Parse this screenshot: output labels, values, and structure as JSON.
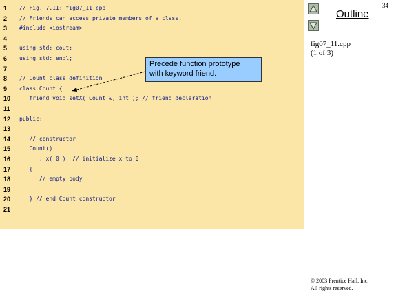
{
  "code": {
    "lines": [
      {
        "number": "1",
        "text": "// Fig. 7.11: fig07_11.cpp"
      },
      {
        "number": "2",
        "text": "// Friends can access private members of a class."
      },
      {
        "number": "3",
        "text": "#include <iostream>"
      },
      {
        "number": "4",
        "text": ""
      },
      {
        "number": "5",
        "text": "using std::cout;"
      },
      {
        "number": "6",
        "text": "using std::endl;"
      },
      {
        "number": "7",
        "text": ""
      },
      {
        "number": "8",
        "text": "// Count class definition"
      },
      {
        "number": "9",
        "text": "class Count {"
      },
      {
        "number": "10",
        "text": "   friend void setX( Count &, int ); // friend declaration"
      },
      {
        "number": "11",
        "text": ""
      },
      {
        "number": "12",
        "text": "public:"
      },
      {
        "number": "13",
        "text": ""
      },
      {
        "number": "14",
        "text": "   // constructor"
      },
      {
        "number": "15",
        "text": "   Count()"
      },
      {
        "number": "16",
        "text": "      : x( 0 )  // initialize x to 0"
      },
      {
        "number": "17",
        "text": "   {"
      },
      {
        "number": "18",
        "text": "      // empty body"
      },
      {
        "number": "19",
        "text": ""
      },
      {
        "number": "20",
        "text": "   } // end Count constructor"
      },
      {
        "number": "21",
        "text": ""
      }
    ]
  },
  "callout": {
    "line1": "Precede function prototype",
    "line2": "with keyword friend."
  },
  "sidebar": {
    "outline_title": "Outline",
    "page_number": "34",
    "file_name": "fig07_11.cpp",
    "page_info": "(1 of 3)",
    "copyright_line1": "© 2003 Prentice Hall, Inc.",
    "copyright_line2": "All rights reserved."
  },
  "colors": {
    "code_background": "#fbe6a7",
    "code_text": "#0b1a8c",
    "callout_background": "#99ccff"
  }
}
